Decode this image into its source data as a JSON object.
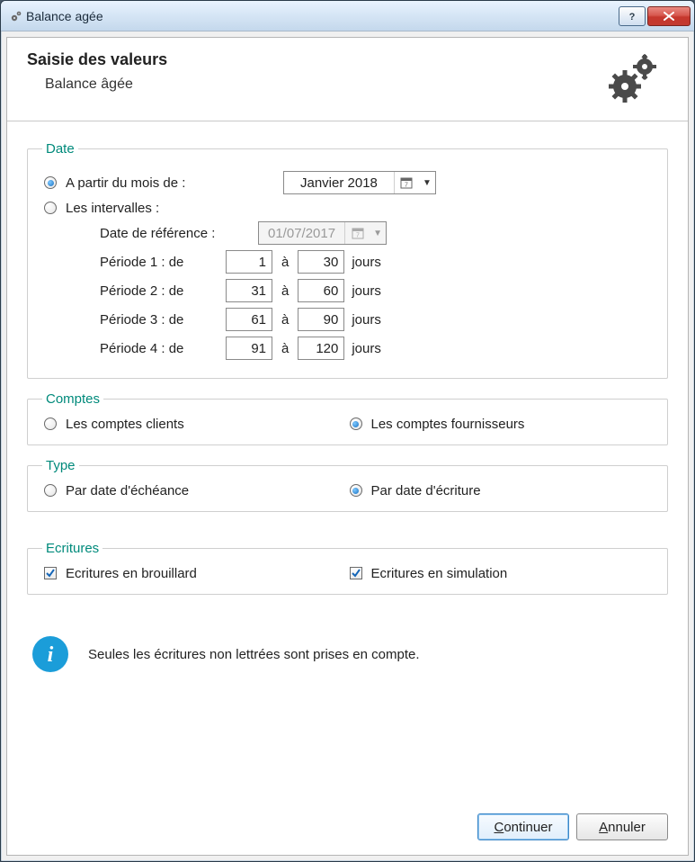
{
  "window": {
    "title": "Balance agée"
  },
  "header": {
    "title": "Saisie des valeurs",
    "subtitle": "Balance âgée"
  },
  "date": {
    "legend": "Date",
    "fromMonth": {
      "label": "A partir du mois de  :",
      "value": "Janvier 2018",
      "selected": true
    },
    "intervals": {
      "label": "Les intervalles :",
      "selected": false
    },
    "reference": {
      "label": "Date de référence  :",
      "value": "01/07/2017"
    },
    "periods": [
      {
        "label": "Période 1 : de",
        "from": "1",
        "to": "30",
        "suffix": "jours",
        "sep": "à"
      },
      {
        "label": "Période 2 : de",
        "from": "31",
        "to": "60",
        "suffix": "jours",
        "sep": "à"
      },
      {
        "label": "Période 3 : de",
        "from": "61",
        "to": "90",
        "suffix": "jours",
        "sep": "à"
      },
      {
        "label": "Période 4 : de",
        "from": "91",
        "to": "120",
        "suffix": "jours",
        "sep": "à"
      }
    ]
  },
  "accounts": {
    "legend": "Comptes",
    "clients": {
      "label": "Les comptes clients",
      "selected": false
    },
    "suppliers": {
      "label": "Les comptes fournisseurs",
      "selected": true
    }
  },
  "type": {
    "legend": "Type",
    "due": {
      "label": "Par date d'échéance",
      "selected": false
    },
    "entry": {
      "label": "Par date d'écriture",
      "selected": true
    }
  },
  "entries": {
    "legend": "Ecritures",
    "fog": {
      "label": "Ecritures en brouillard",
      "checked": true
    },
    "sim": {
      "label": "Ecritures en simulation",
      "checked": true
    }
  },
  "info": {
    "text": "Seules les écritures non lettrées sont prises en compte."
  },
  "buttons": {
    "continue": "Continuer",
    "cancel": "Annuler"
  }
}
